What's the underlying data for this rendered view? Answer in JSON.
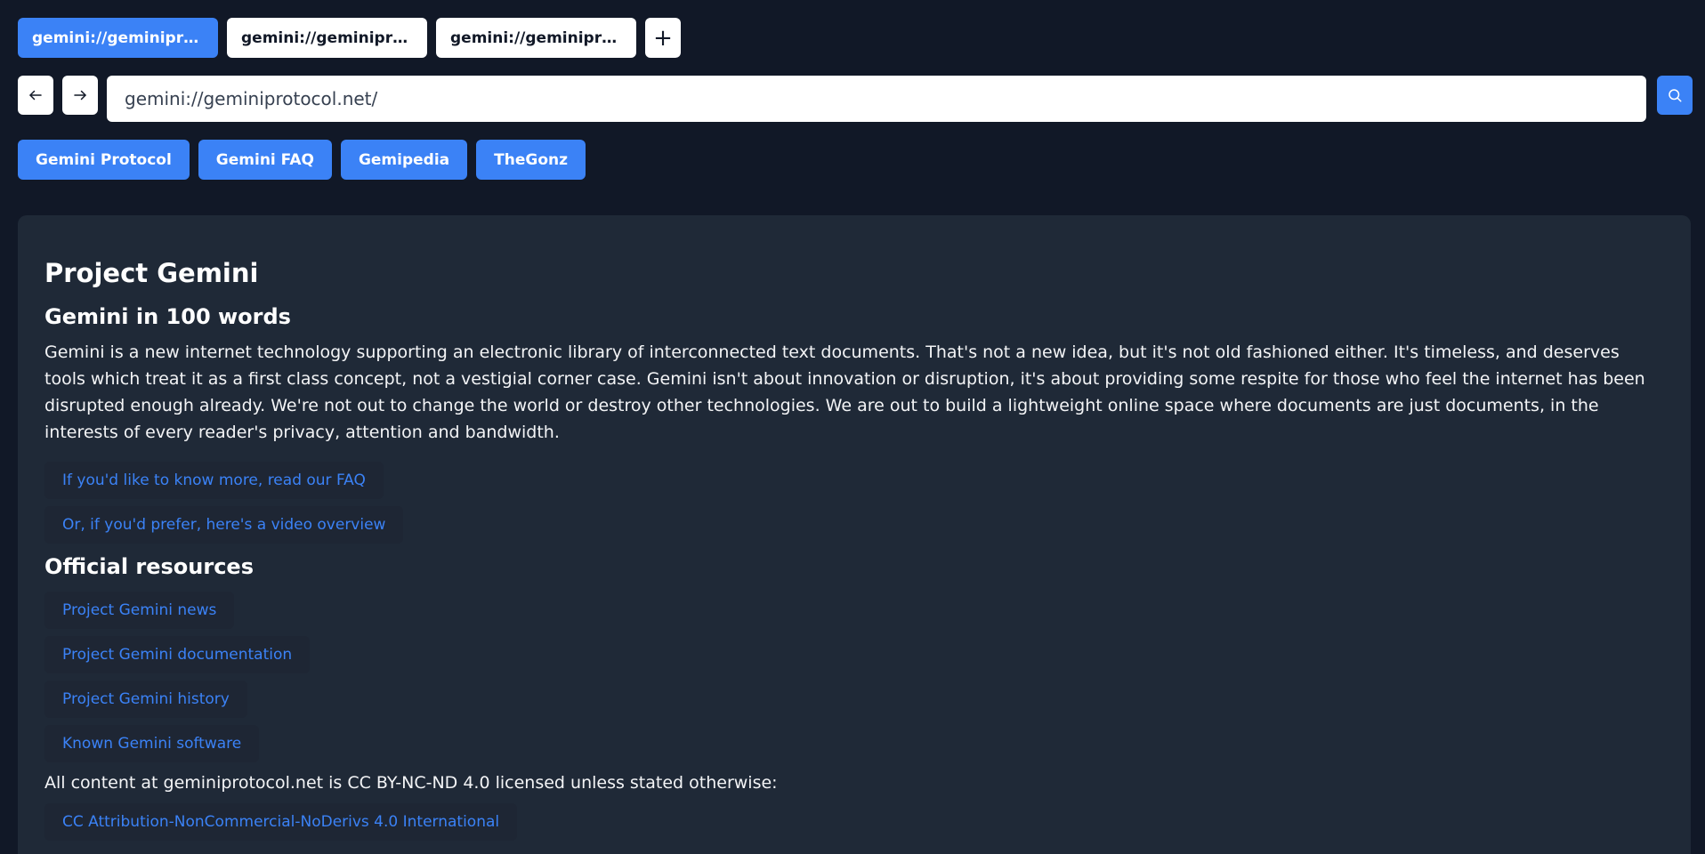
{
  "tabs": [
    {
      "label": "gemini://geminiprotocol.net/",
      "active": true
    },
    {
      "label": "gemini://geminiprotocol.net/",
      "active": false
    },
    {
      "label": "gemini://geminiprotocol.net/",
      "active": false
    }
  ],
  "tab_add_label": "+",
  "nav": {
    "back_glyph": "←",
    "forward_glyph": "→",
    "url_value": "gemini://geminiprotocol.net/"
  },
  "bookmarks": [
    "Gemini Protocol",
    "Gemini FAQ",
    "Gemipedia",
    "TheGonz"
  ],
  "page": {
    "title": "Project Gemini",
    "section1_heading": "Gemini in 100 words",
    "section1_paragraph": "Gemini is a new internet technology supporting an electronic library of interconnected text documents. That's not a new idea, but it's not old fashioned either. It's timeless, and deserves tools which treat it as a first class concept, not a vestigial corner case. Gemini isn't about innovation or disruption, it's about providing some respite for those who feel the internet has been disrupted enough already. We're not out to change the world or destroy other technologies. We are out to build a lightweight online space where documents are just documents, in the interests of every reader's privacy, attention and bandwidth.",
    "section1_links": [
      "If you'd like to know more, read our FAQ",
      "Or, if you'd prefer, here's a video overview"
    ],
    "section2_heading": "Official resources",
    "section2_links": [
      "Project Gemini news",
      "Project Gemini documentation",
      "Project Gemini history",
      "Known Gemini software"
    ],
    "license_text": "All content at geminiprotocol.net is CC BY-NC-ND 4.0 licensed unless stated otherwise:",
    "license_link": "CC Attribution-NonCommercial-NoDerivs 4.0 International"
  },
  "colors": {
    "background": "#111827",
    "panel": "#1f2937",
    "accent": "#3b82f6"
  },
  "icons": {
    "back": "arrow-left-icon",
    "forward": "arrow-right-icon",
    "search": "search-icon",
    "add": "plus-icon"
  }
}
